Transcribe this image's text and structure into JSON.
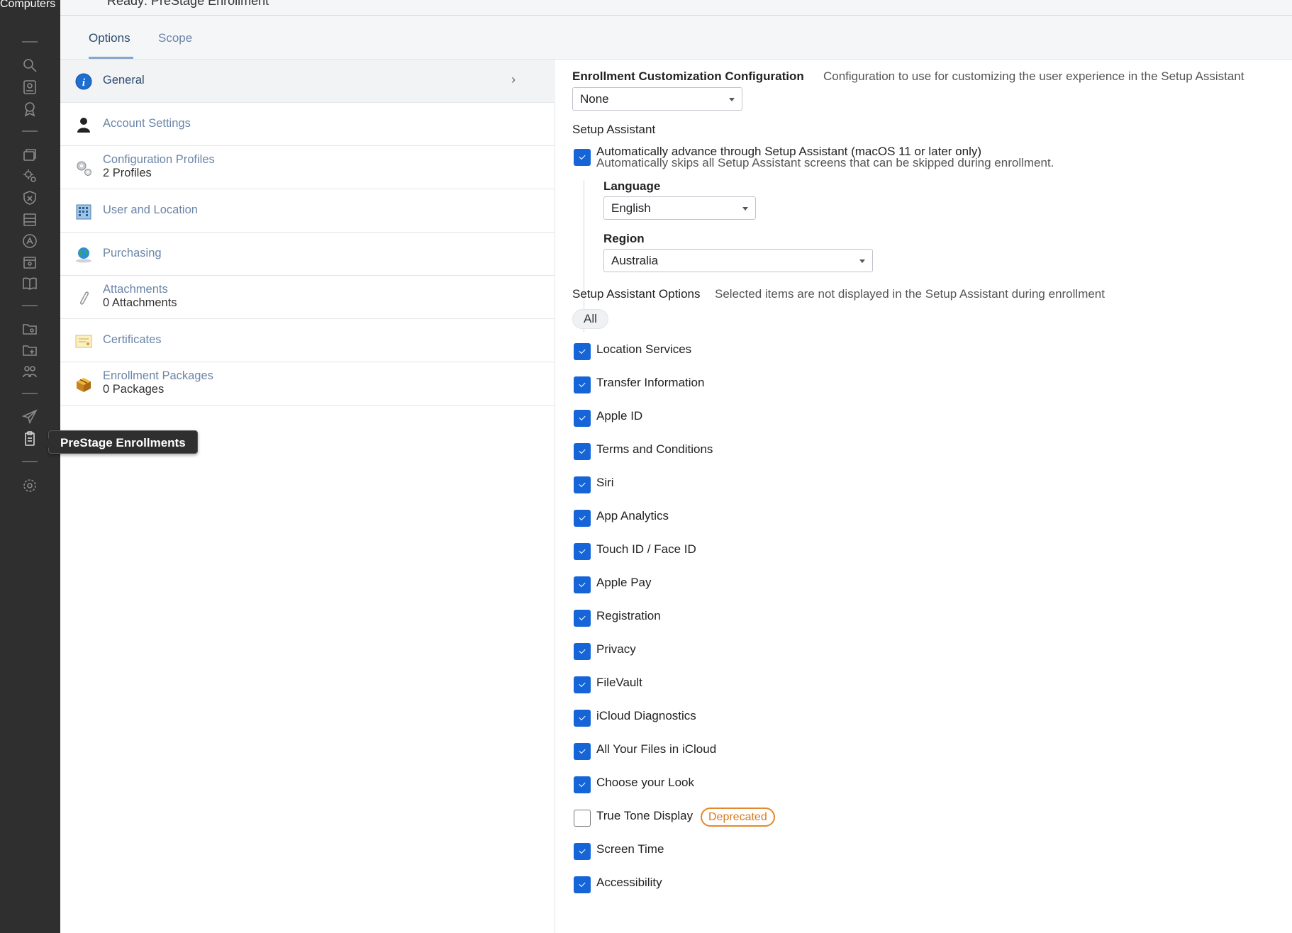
{
  "rail": {
    "title": "Computers",
    "tooltip": "PreStage Enrollments"
  },
  "header": {
    "breadcrumb": "Ready: PreStage Enrollment"
  },
  "tabs": [
    {
      "label": "Options"
    },
    {
      "label": "Scope"
    }
  ],
  "nav": [
    {
      "label": "General",
      "sub": ""
    },
    {
      "label": "Account Settings",
      "sub": ""
    },
    {
      "label": "Configuration Profiles",
      "sub": "2 Profiles"
    },
    {
      "label": "User and Location",
      "sub": ""
    },
    {
      "label": "Purchasing",
      "sub": ""
    },
    {
      "label": "Attachments",
      "sub": "0 Attachments"
    },
    {
      "label": "Certificates",
      "sub": ""
    },
    {
      "label": "Enrollment Packages",
      "sub": "0 Packages"
    }
  ],
  "main": {
    "customization": {
      "label": "Enrollment Customization Configuration",
      "help": "Configuration to use for customizing the user experience in the Setup Assistant",
      "value": "None"
    },
    "setup_assistant": {
      "heading": "Setup Assistant",
      "auto_advance_label": "Automatically advance through Setup Assistant (macOS 11 or later only)",
      "auto_advance_help": "Automatically skips all Setup Assistant screens that can be skipped during enrollment.",
      "auto_advance_checked": true,
      "language_label": "Language",
      "language_value": "English",
      "region_label": "Region",
      "region_value": "Australia"
    },
    "options_heading": "Setup Assistant Options",
    "options_help": "Selected items are not displayed in the Setup Assistant during enrollment",
    "all_button": "All",
    "options": [
      {
        "label": "Location Services",
        "checked": true
      },
      {
        "label": "Transfer Information",
        "checked": true
      },
      {
        "label": "Apple ID",
        "checked": true
      },
      {
        "label": "Terms and Conditions",
        "checked": true
      },
      {
        "label": "Siri",
        "checked": true
      },
      {
        "label": "App Analytics",
        "checked": true
      },
      {
        "label": "Touch ID / Face ID",
        "checked": true
      },
      {
        "label": "Apple Pay",
        "checked": true
      },
      {
        "label": "Registration",
        "checked": true
      },
      {
        "label": "Privacy",
        "checked": true
      },
      {
        "label": "FileVault",
        "checked": true
      },
      {
        "label": "iCloud Diagnostics",
        "checked": true
      },
      {
        "label": "All Your Files in iCloud",
        "checked": true
      },
      {
        "label": "Choose your Look",
        "checked": true
      },
      {
        "label": "True Tone Display",
        "checked": false,
        "badge": "Deprecated"
      },
      {
        "label": "Screen Time",
        "checked": true
      },
      {
        "label": "Accessibility",
        "checked": true
      }
    ]
  }
}
